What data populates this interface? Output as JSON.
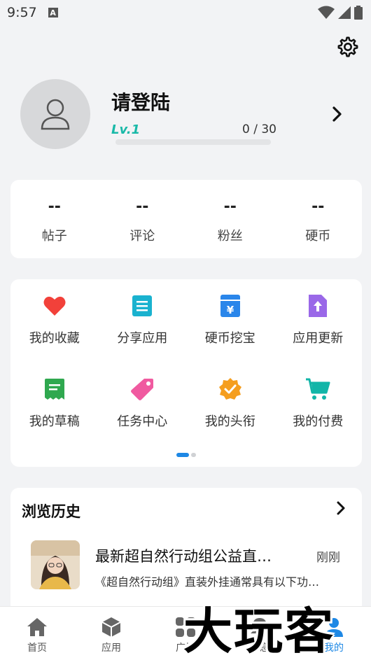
{
  "status_bar": {
    "time": "9:57",
    "notification_badge": "A"
  },
  "profile": {
    "login_prompt": "请登陆",
    "level": "Lv.1",
    "exp_text": "0 / 30",
    "exp_progress": 0,
    "accent_color": "#19b9a8"
  },
  "stats": [
    {
      "value": "--",
      "label": "帖子"
    },
    {
      "value": "--",
      "label": "评论"
    },
    {
      "value": "--",
      "label": "粉丝"
    },
    {
      "value": "--",
      "label": "硬币"
    }
  ],
  "menu": [
    {
      "label": "我的收藏",
      "icon": "heart-icon",
      "color": "#f2413a"
    },
    {
      "label": "分享应用",
      "icon": "document-icon",
      "color": "#1ab2cf"
    },
    {
      "label": "硬币挖宝",
      "icon": "yen-box-icon",
      "color": "#2a86ea"
    },
    {
      "label": "应用更新",
      "icon": "upload-file-icon",
      "color": "#9a68e8"
    },
    {
      "label": "我的草稿",
      "icon": "draft-icon",
      "color": "#2fa84f"
    },
    {
      "label": "任务中心",
      "icon": "tag-icon",
      "color": "#f05aa0"
    },
    {
      "label": "我的头衔",
      "icon": "badge-check-icon",
      "color": "#f59e1e"
    },
    {
      "label": "我的付费",
      "icon": "cart-icon",
      "color": "#12b5a8"
    }
  ],
  "history": {
    "title": "浏览历史",
    "items": [
      {
        "name": "最新超自然行动组公益直…",
        "time": "刚刚",
        "description": "《超自然行动组》直装外挂通常具有以下功…"
      }
    ]
  },
  "bottom_nav": [
    {
      "label": "首页",
      "icon": "home-icon"
    },
    {
      "label": "应用",
      "icon": "cube-icon"
    },
    {
      "label": "广场",
      "icon": "grid-icon"
    },
    {
      "label": "消息",
      "icon": "bell-icon"
    },
    {
      "label": "我的",
      "icon": "user-icon"
    }
  ],
  "watermark": "大玩客"
}
